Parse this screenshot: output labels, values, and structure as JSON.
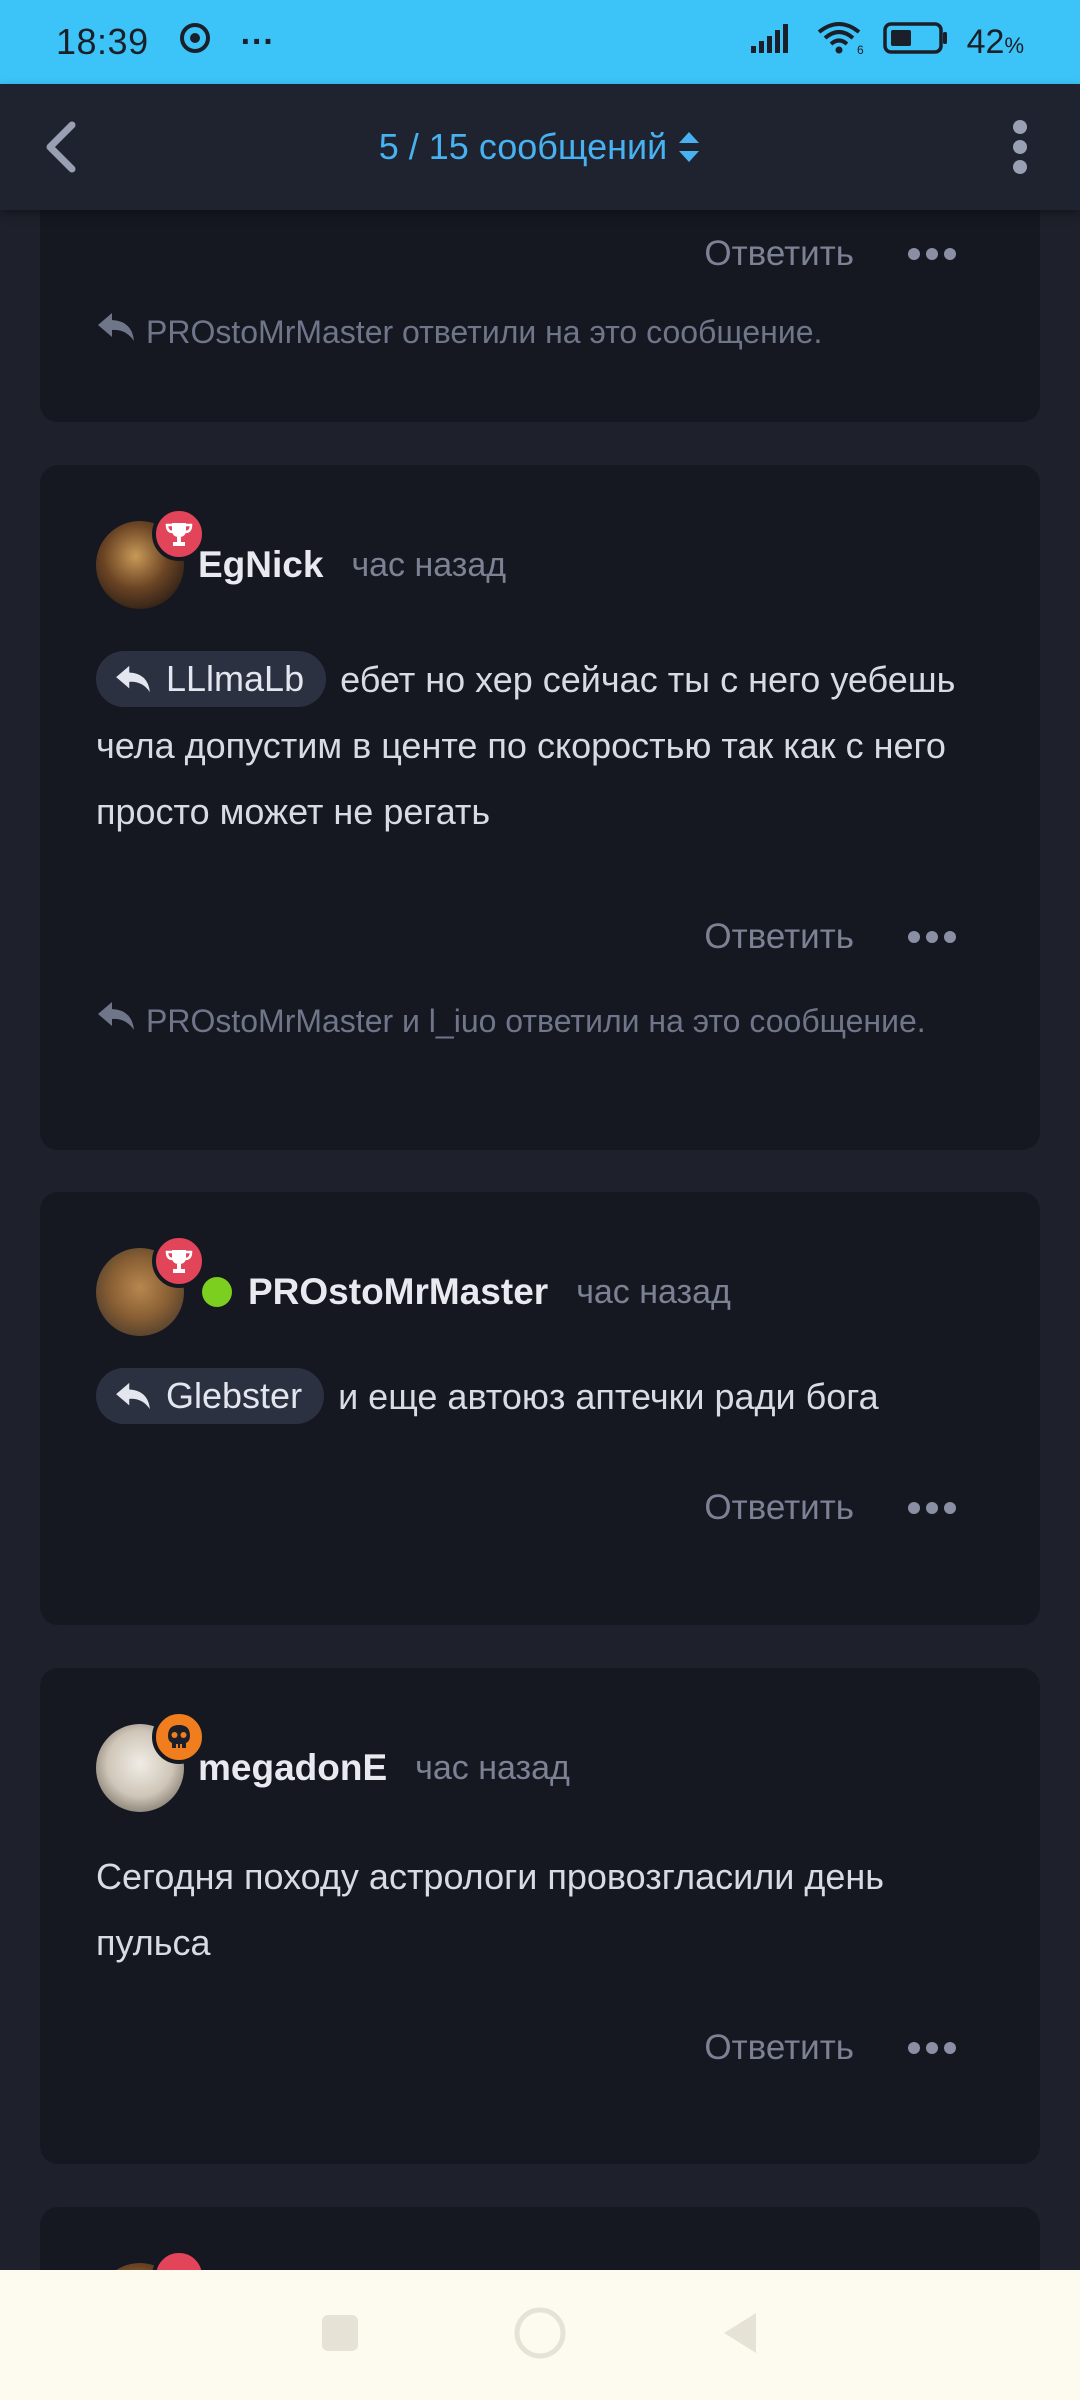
{
  "status_bar": {
    "time": "18:39",
    "more_indicator": "···",
    "battery_percent": "42",
    "battery_unit": "%"
  },
  "app_bar": {
    "pager_label": "5 / 15 сообщений"
  },
  "colors": {
    "status_bar": "#3cc4f8",
    "accent": "#48b1f1",
    "card": "#151821",
    "background": "#1e212c",
    "badge_red": "#e2455a",
    "badge_orange": "#f07d1e",
    "online": "#7ccf1e"
  },
  "posts": [
    {
      "reply_label": "Ответить",
      "replied_note": "PROstoMrMaster ответили на это сообщение."
    },
    {
      "author": "EgNick",
      "time": "час назад",
      "badge_icon": "trophy-icon",
      "mention": "LLlmaLb",
      "text": "ебет но хер сейчас ты с него уебешь чела допустим в центе по скоростью так как с него просто может не регать",
      "reply_label": "Ответить",
      "replied_note": "PROstoMrMaster и l_iuo ответили на это сообщение."
    },
    {
      "author": "PROstoMrMaster",
      "time": "час назад",
      "badge_icon": "trophy-icon",
      "online": true,
      "mention": "Glebster",
      "text": "и еще автоюз аптечки ради бога",
      "reply_label": "Ответить"
    },
    {
      "author": "megadonE",
      "time": "час назад",
      "badge_icon": "skull-icon",
      "text": "Сегодня походу астрологи провозгласили день пульса",
      "reply_label": "Ответить"
    }
  ]
}
